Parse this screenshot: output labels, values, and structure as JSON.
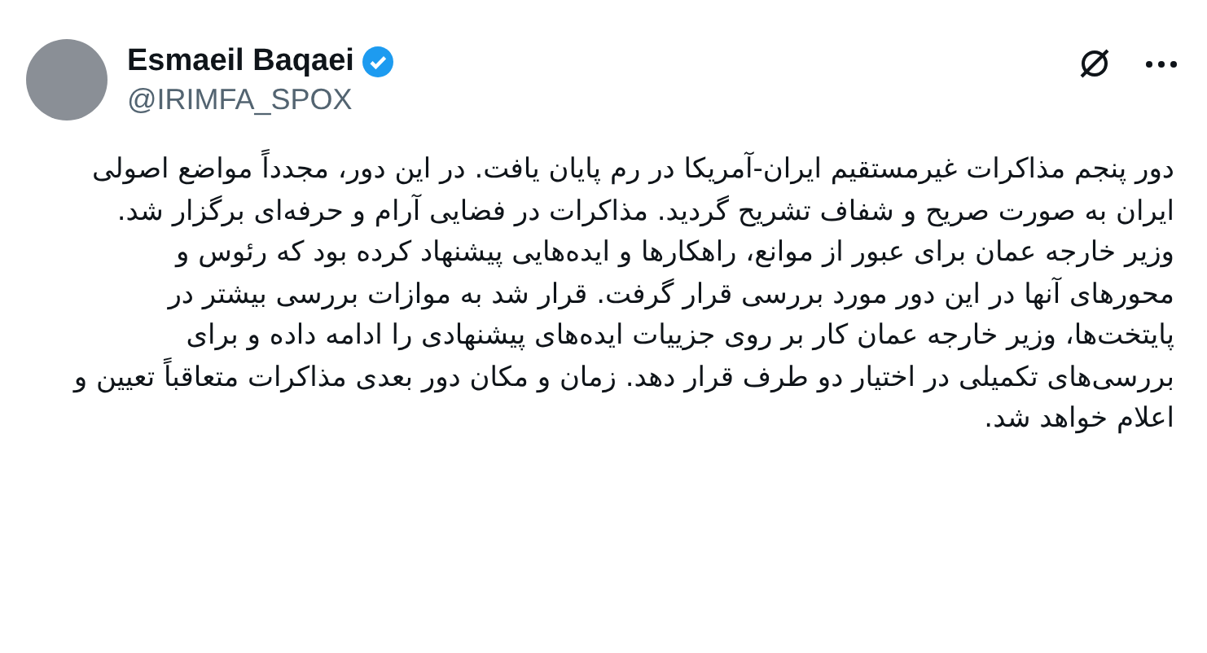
{
  "author": {
    "name": "Esmaeil Baqaei",
    "handle": "@IRIMFA_SPOX",
    "verified": true
  },
  "paragraphs": [
    "دور پنجم مذاکرات غیرمستقیم ایران-آمریکا در رم پایان یافت. در این دور، مجدداً مواضع اصولی ایران به صورت صریح و شفاف تشریح گردید. مذاکرات در فضایی آرام و حرفه‌ای برگزار شد.",
    "وزیر خارجه عمان برای عبور از موانع، راهکارها و ایده‌هایی پیشنهاد کرده بود که رئوس و محورهای آنها در این دور مورد بررسی قرار گرفت. قرار شد به موازات بررسی بیشتر در پایتخت‌ها، وزیر خارجه عمان کار بر روی جزییات ایده‌های پیشنهادی را ادامه داده و برای بررسی‌های تکمیلی در اختیار دو طرف قرار دهد. زمان و مکان دور بعدی مذاکرات متعاقباً تعیین و اعلام خواهد شد."
  ]
}
